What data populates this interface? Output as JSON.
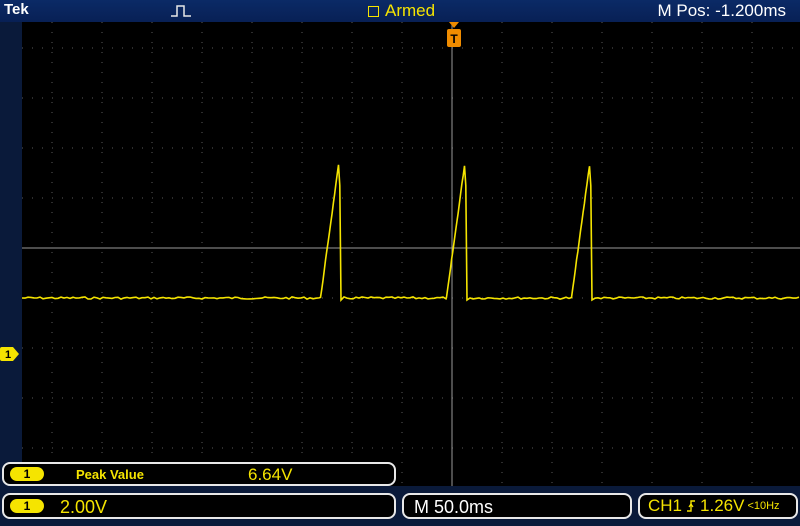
{
  "window": {
    "brand": "Tek",
    "status": "Armed",
    "m_pos": "M Pos: -1.200ms"
  },
  "channel": {
    "id": "1",
    "scale": "2.00V",
    "color": "#f5e400"
  },
  "measurement": {
    "channel": "1",
    "label": "Peak Value",
    "value": "6.64V"
  },
  "timebase": {
    "value": "M 50.0ms"
  },
  "trigger": {
    "source": "CH1",
    "level": "1.26V",
    "freq": "<10Hz",
    "edge_icon": "rising-edge-icon"
  },
  "icons": {
    "trigger_mode": "pulse-icon",
    "trigger_position": "trigger-position-marker-icon",
    "channel_ground": "channel-1-ground-marker-icon"
  },
  "waveform": {
    "baseline_div": -1.0,
    "peak_div": 1.65,
    "peak_times_div": [
      -2.27,
      0.25,
      2.75
    ],
    "rise_div": 0.36,
    "fall_div": 0.05
  }
}
